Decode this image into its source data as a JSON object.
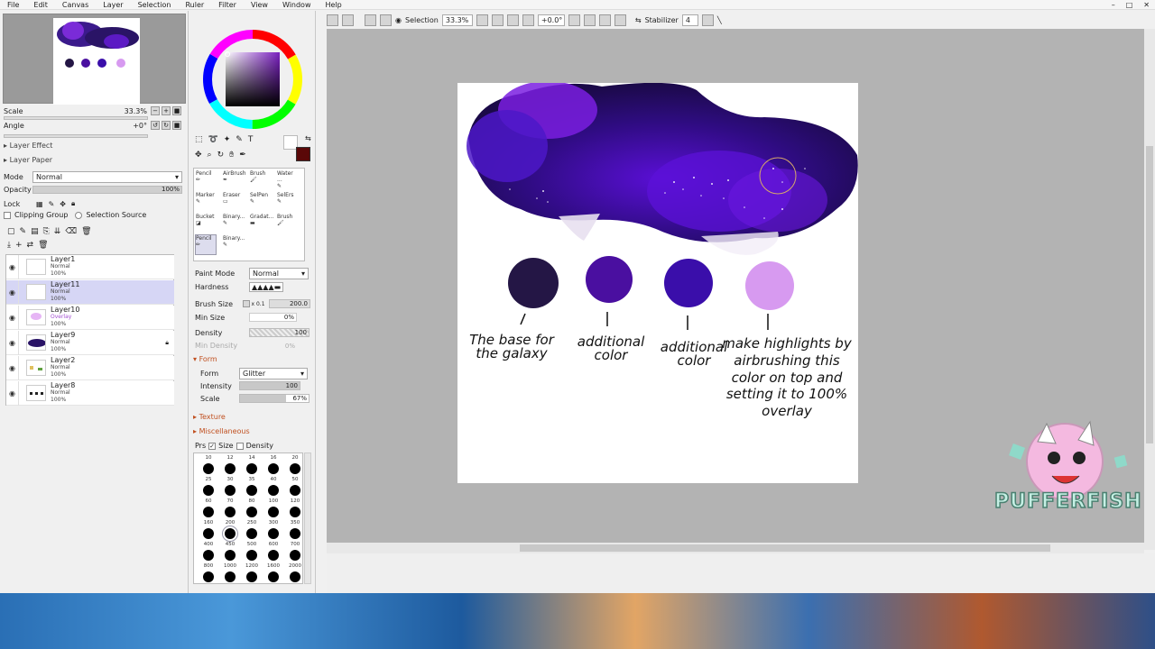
{
  "menu": [
    "File",
    "Edit",
    "Canvas",
    "Layer",
    "Selection",
    "Ruler",
    "Filter",
    "View",
    "Window",
    "Help"
  ],
  "window_controls": [
    "–",
    "□",
    "✕"
  ],
  "navigator": {
    "scale_label": "Scale",
    "scale_value": "33.3%",
    "angle_label": "Angle",
    "angle_value": "+0°"
  },
  "layer_panel": {
    "layer_effect": "Layer Effect",
    "layer_paper": "Layer Paper",
    "mode_label": "Mode",
    "mode_value": "Normal",
    "opacity_label": "Opacity",
    "opacity_value": "100%",
    "lock_label": "Lock",
    "clipping_group": "Clipping Group",
    "selection_source": "Selection Source",
    "layers": [
      {
        "name": "Layer1",
        "mode": "Normal",
        "opacity": "100%",
        "selected": false
      },
      {
        "name": "Layer11",
        "mode": "Normal",
        "opacity": "100%",
        "selected": true
      },
      {
        "name": "Layer10",
        "mode": "Overlay",
        "opacity": "100%",
        "selected": false
      },
      {
        "name": "Layer9",
        "mode": "Normal",
        "opacity": "100%",
        "selected": false
      },
      {
        "name": "Layer2",
        "mode": "Normal",
        "opacity": "100%",
        "selected": false
      },
      {
        "name": "Layer8",
        "mode": "Normal",
        "opacity": "100%",
        "selected": false
      }
    ]
  },
  "tools": {
    "row1": [
      "Pencil",
      "AirBrush",
      "Brush",
      "Water ..."
    ],
    "row2": [
      "Marker",
      "Eraser",
      "SelPen",
      "SelErs"
    ],
    "row3": [
      "Bucket",
      "Binary...",
      "Gradat...",
      "Brush"
    ],
    "row4": [
      "Pencil",
      "Binary..."
    ]
  },
  "brush_settings": {
    "paint_mode_label": "Paint Mode",
    "paint_mode_value": "Normal",
    "hardness_label": "Hardness",
    "brush_size_label": "Brush Size",
    "brush_size_mult": "x 0.1",
    "brush_size_value": "200.0",
    "min_size_label": "Min Size",
    "min_size_value": "0%",
    "density_label": "Density",
    "density_value": "100",
    "min_density_label": "Min Density",
    "min_density_value": "0%",
    "form_section": "Form",
    "form_label": "Form",
    "form_value": "Glitter",
    "intensity_label": "Intensity",
    "intensity_value": "100",
    "scale_label": "Scale",
    "scale_value": "67%",
    "texture_section": "Texture",
    "misc_section": "Miscellaneous",
    "prs_label": "Prs",
    "size_label": "Size",
    "density_chk_label": "Density"
  },
  "brush_sizes": [
    [
      "10",
      "12",
      "14",
      "16",
      "20"
    ],
    [
      "25",
      "30",
      "35",
      "40",
      "50"
    ],
    [
      "60",
      "70",
      "80",
      "100",
      "120"
    ],
    [
      "160",
      "200",
      "250",
      "300",
      "350"
    ],
    [
      "400",
      "450",
      "500",
      "600",
      "700"
    ],
    [
      "800",
      "1000",
      "1200",
      "1600",
      "2000"
    ]
  ],
  "toolbar": {
    "selection_label": "Selection",
    "zoom": "33.3%",
    "angle": "+0.0°",
    "stabilizer_label": "Stabilizer",
    "stabilizer_value": "4"
  },
  "canvas_notes": [
    "The base for the galaxy",
    "additional color",
    "additional color",
    "make highlights by airbrushing this color on top and setting it to 100% overlay"
  ],
  "swatch_colors": [
    "#241645",
    "#4a0fa0",
    "#3a0eaa",
    "#d79af0"
  ],
  "watermark": "PUFFERFISH"
}
